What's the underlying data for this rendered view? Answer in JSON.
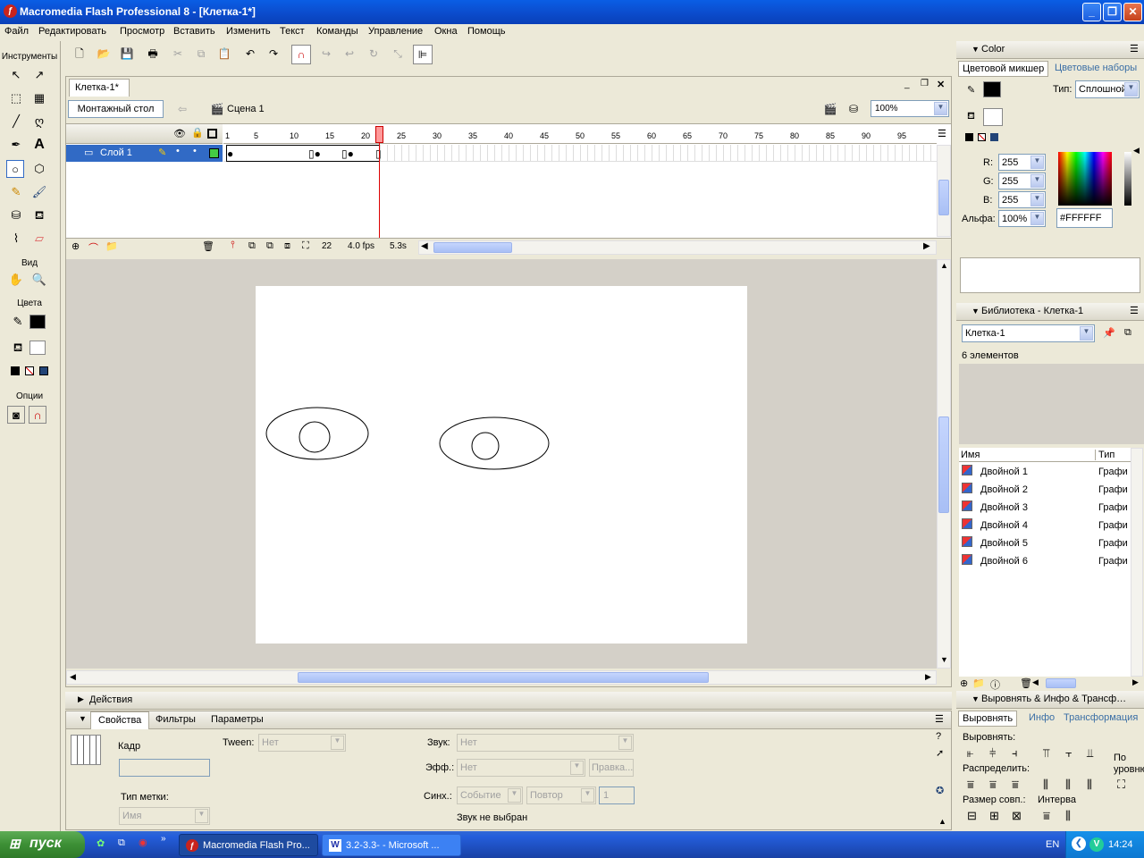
{
  "window": {
    "title": "Macromedia Flash Professional 8 - [Клетка-1*]",
    "min": "_",
    "max": "❐",
    "close": "✕"
  },
  "menu": [
    "Файл",
    "Редактировать",
    "Просмотр",
    "Вставить",
    "Изменить",
    "Текст",
    "Команды",
    "Управление",
    "Окна",
    "Помощь"
  ],
  "tools": {
    "title": "Инструменты",
    "view": "Вид",
    "colors": "Цвета",
    "options": "Опции"
  },
  "document": {
    "tab": "Клетка-1*",
    "stage_button": "Монтажный стол",
    "scene": "Сцена 1",
    "zoom": "100%"
  },
  "timeline": {
    "layer": "Слой 1",
    "ticks": [
      "1",
      "5",
      "10",
      "15",
      "20",
      "25",
      "30",
      "35",
      "40",
      "45",
      "50",
      "55",
      "60",
      "65",
      "70",
      "75",
      "80",
      "85",
      "90",
      "95"
    ],
    "current_frame": "22",
    "fps": "4.0 fps",
    "time": "5.3s"
  },
  "color_panel": {
    "title": "Color",
    "tab_mixer": "Цветовой микшер",
    "tab_swatches": "Цветовые наборы",
    "type_label": "Тип:",
    "type_value": "Сплошной",
    "r_label": "R:",
    "r": "255",
    "g_label": "G:",
    "g": "255",
    "b_label": "B:",
    "b": "255",
    "alpha_label": "Альфа:",
    "alpha": "100%",
    "hex": "#FFFFFF"
  },
  "library": {
    "title": "Библиотека - Клетка-1",
    "doc": "Клетка-1",
    "count": "6 элементов",
    "col_name": "Имя",
    "col_type": "Тип",
    "items": [
      {
        "name": "Двойной 1",
        "type": "Графи"
      },
      {
        "name": "Двойной 2",
        "type": "Графи"
      },
      {
        "name": "Двойной 3",
        "type": "Графи"
      },
      {
        "name": "Двойной 4",
        "type": "Графи"
      },
      {
        "name": "Двойной 5",
        "type": "Графи"
      },
      {
        "name": "Двойной 6",
        "type": "Графи"
      }
    ]
  },
  "align_panel": {
    "title": "Выровнять & Инфо & Трансф…",
    "tab_align": "Выровнять",
    "tab_info": "Инфо",
    "tab_transform": "Трансформация",
    "align_label": "Выровнять:",
    "distribute_label": "Распределить:",
    "match_label": "Размер совп.:",
    "space_label": "Интерва",
    "to_stage_1": "По",
    "to_stage_2": "уровню"
  },
  "actions": {
    "title": "Действия"
  },
  "properties": {
    "tab_props": "Свойства",
    "tab_filters": "Фильтры",
    "tab_params": "Параметры",
    "frame_label": "Кадр",
    "tween_label": "Tween:",
    "tween_value": "Нет",
    "label_type": "Тип метки:",
    "label_type_value": "Имя",
    "sound_label": "Звук:",
    "sound_value": "Нет",
    "effect_label": "Эфф.:",
    "effect_value": "Нет",
    "edit_button": "Правка...",
    "sync_label": "Синх.:",
    "sync_value": "Событие",
    "repeat_value": "Повтор",
    "repeat_count": "1",
    "no_sound": "Звук не выбран"
  },
  "taskbar": {
    "start": "пуск",
    "task1": "Macromedia Flash Pro...",
    "task2": "3.2-3.3- - Microsoft ...",
    "lang": "EN",
    "clock": "14:24"
  }
}
